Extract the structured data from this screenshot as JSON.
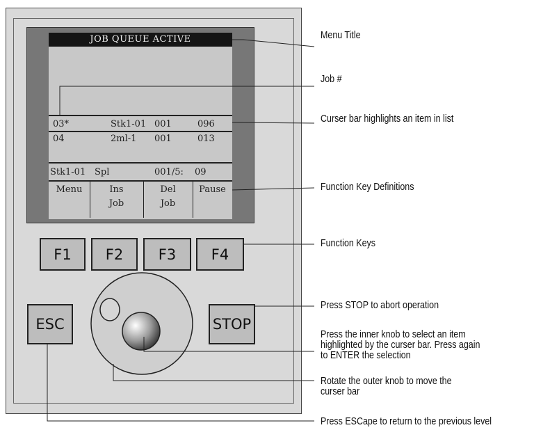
{
  "screen": {
    "title": "JOB QUEUE ACTIVE",
    "rows": [
      {
        "job": "03*",
        "stack": "Stk1-01",
        "qty": "001",
        "num": "096"
      },
      {
        "job": "04",
        "stack": "2ml-1",
        "qty": "001",
        "num": "013"
      }
    ],
    "status": {
      "stack": "Stk1-01",
      "type": "Spl",
      "progress": "001/5:",
      "time": "09"
    },
    "function_keys": [
      {
        "line1": "Menu",
        "line2": ""
      },
      {
        "line1": "Ins",
        "line2": "Job"
      },
      {
        "line1": "Del",
        "line2": "Job"
      },
      {
        "line1": "Pause",
        "line2": ""
      }
    ]
  },
  "keys": {
    "f1": "F1",
    "f2": "F2",
    "f3": "F3",
    "f4": "F4",
    "esc": "ESC",
    "stop": "STOP"
  },
  "annotations": {
    "menu_title": "Menu Title",
    "job_number": "Job #",
    "curser_bar": "Curser bar highlights an item in list",
    "function_key_definitions": "Function Key Definitions",
    "function_keys": "Function Keys",
    "stop": "Press STOP to abort operation",
    "inner_knob_1": "Press the inner knob to select an item",
    "inner_knob_2": "highlighted by the curser bar. Press again",
    "inner_knob_3": "to ENTER the selection",
    "outer_knob_1": "Rotate the outer knob to move the",
    "outer_knob_2": "curser bar",
    "esc": "Press ESCape to return to the previous level"
  },
  "colors": {
    "device_body": "#d9d9d9",
    "screen_frame": "#777777",
    "lcd_background": "#c8c8c8",
    "title_bar": "#151515",
    "key_face": "#bdbdbd"
  }
}
